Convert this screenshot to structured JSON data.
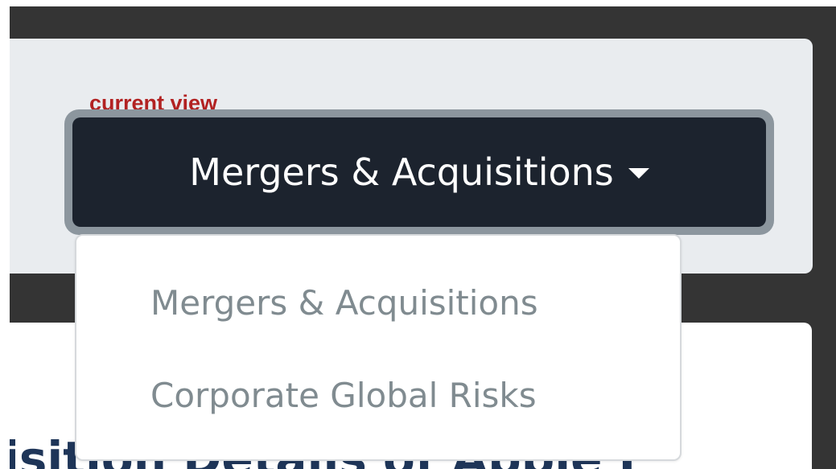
{
  "view_selector": {
    "label": "current view",
    "selected_value": "Mergers & Acquisitions",
    "caret_icon": "caret-down-icon",
    "colors": {
      "label_text": "#b22222",
      "button_bg": "#1c232e",
      "button_focus_ring": "#8c969e",
      "button_text": "#ffffff"
    }
  },
  "dropdown_menu": {
    "items": [
      {
        "label": "Mergers & Acquisitions"
      },
      {
        "label": "Corporate Global Risks"
      }
    ],
    "colors": {
      "menu_bg": "#ffffff",
      "item_text": "#808b90",
      "border": "#d6d9dc"
    }
  },
  "content_card": {
    "heading_partial": "isition Details of Apple I"
  },
  "colors": {
    "page_dark": "#343434",
    "panel_bg": "#e9ecef",
    "heading_text": "#1e3558"
  }
}
